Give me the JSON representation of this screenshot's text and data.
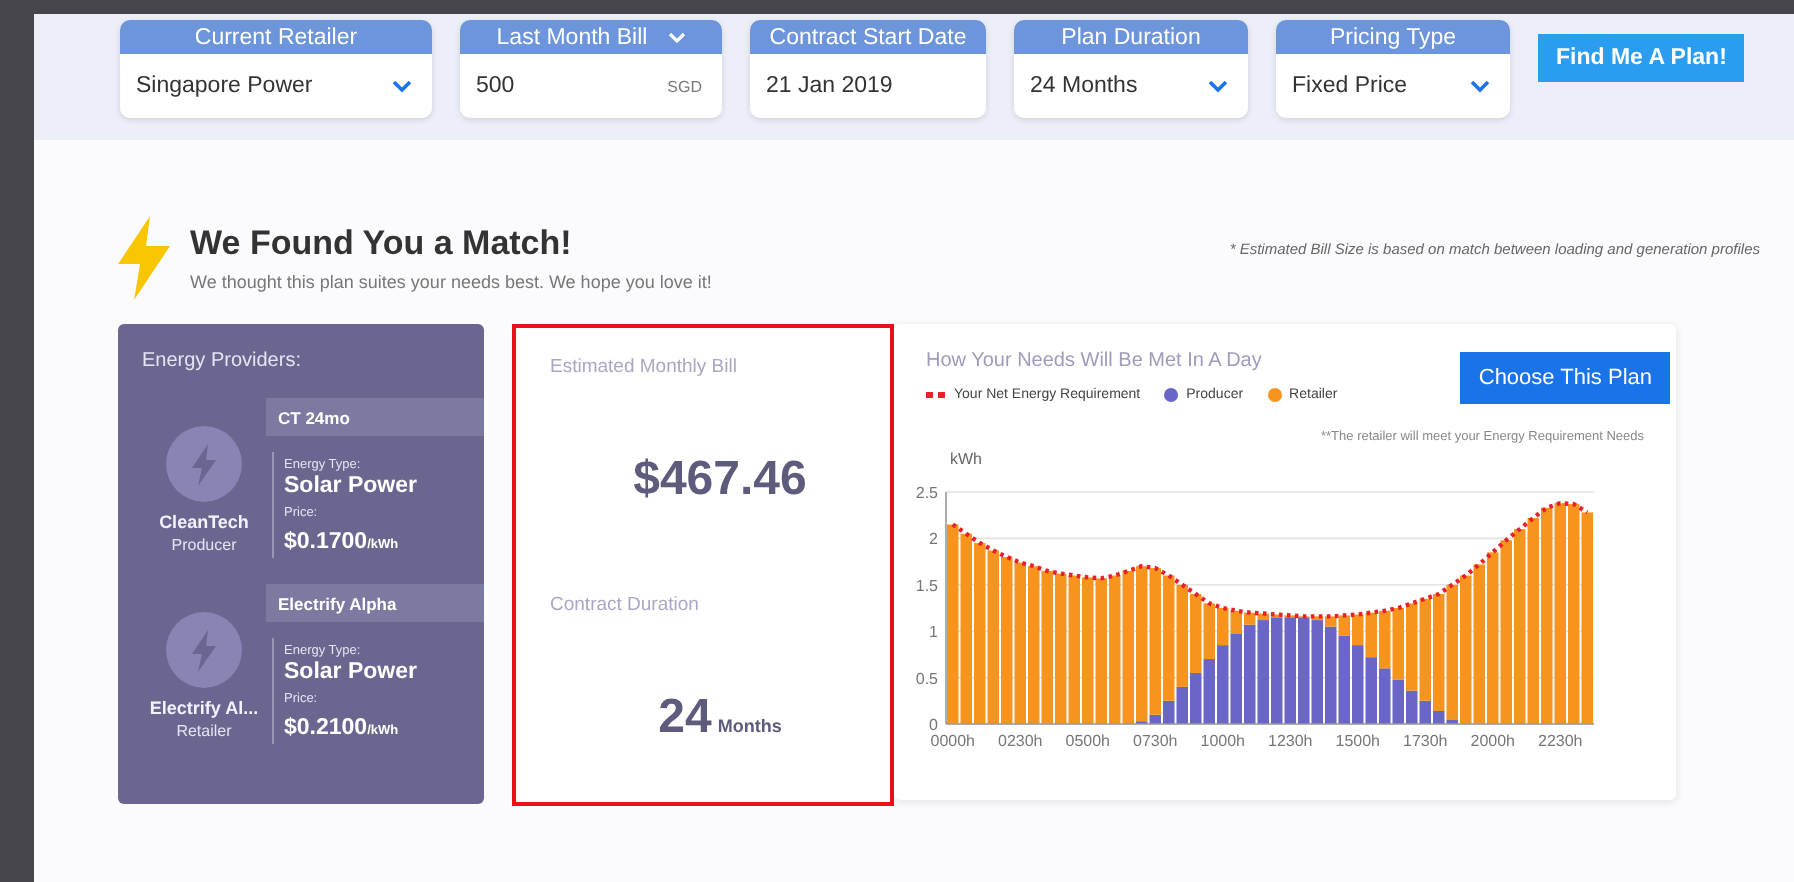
{
  "filters": [
    {
      "label": "Current Retailer",
      "value": "Singapore Power",
      "kind": "dropdown",
      "header_caret": false
    },
    {
      "label": "Last Month Bill",
      "value": "500",
      "suffix": "SGD",
      "kind": "amount",
      "header_caret": true
    },
    {
      "label": "Contract Start Date",
      "value": "21 Jan 2019",
      "kind": "date",
      "header_caret": false
    },
    {
      "label": "Plan Duration",
      "value": "24 Months",
      "kind": "dropdown",
      "header_caret": false
    },
    {
      "label": "Pricing Type",
      "value": "Fixed Price",
      "kind": "dropdown",
      "header_caret": false
    }
  ],
  "search_button": "Find Me A Plan!",
  "match": {
    "title": "We Found You a Match!",
    "subtitle": "We thought this plan suites your needs best. We hope you love it!",
    "note": "* Estimated Bill Size is based on match between loading and generation profiles"
  },
  "providers": {
    "title": "Energy Providers:",
    "items": [
      {
        "name": "CleanTech",
        "role": "Producer",
        "plan": "CT 24mo",
        "type_label": "Energy Type:",
        "type": "Solar Power",
        "price_label": "Price:",
        "price": "$0.1700",
        "unit": "/kWh"
      },
      {
        "name": "Electrify Al...",
        "role": "Retailer",
        "plan": "Electrify Alpha",
        "type_label": "Energy Type:",
        "type": "Solar Power",
        "price_label": "Price:",
        "price": "$0.2100",
        "unit": "/kWh"
      }
    ]
  },
  "bill": {
    "highlighted": true,
    "bill_label": "Estimated Monthly Bill",
    "bill": "$467.46",
    "duration_label": "Contract Duration",
    "duration": "24",
    "duration_unit": "Months"
  },
  "needs": {
    "title": "How Your Needs Will Be Met In A Day",
    "button": "Choose This Plan",
    "note": "**The retailer will meet your Energy Requirement Needs",
    "chart_data": {
      "type": "bar",
      "stacked": true,
      "grid": true,
      "ylabel": "kWh",
      "ylim": [
        0,
        2.5
      ],
      "yticks": [
        0,
        0.5,
        1,
        {
          "value": 1.5,
          "label": "1.5"
        },
        2,
        {
          "value": 2.5,
          "label": "2.5"
        }
      ],
      "categories": [
        "0000h",
        null,
        null,
        null,
        null,
        "0230h",
        null,
        null,
        null,
        null,
        "0500h",
        null,
        null,
        null,
        null,
        "0730h",
        null,
        null,
        null,
        null,
        "1000h",
        null,
        null,
        null,
        null,
        "1230h",
        null,
        null,
        null,
        null,
        "1500h",
        null,
        null,
        null,
        null,
        "1730h",
        null,
        null,
        null,
        null,
        "2000h",
        null,
        null,
        null,
        null,
        "2230h",
        null,
        null
      ],
      "series": [
        {
          "name": "Your Net Energy Requirement",
          "type": "line",
          "line_style": "dotted",
          "color": "#e8202a",
          "values": [
            2.15,
            2.05,
            1.95,
            1.87,
            1.8,
            1.74,
            1.7,
            1.65,
            1.62,
            1.6,
            1.58,
            1.57,
            1.6,
            1.65,
            1.7,
            1.68,
            1.6,
            1.5,
            1.4,
            1.3,
            1.25,
            1.22,
            1.2,
            1.19,
            1.18,
            1.17,
            1.16,
            1.16,
            1.16,
            1.17,
            1.18,
            1.2,
            1.22,
            1.25,
            1.3,
            1.35,
            1.4,
            1.5,
            1.6,
            1.72,
            1.85,
            1.98,
            2.1,
            2.22,
            2.33,
            2.38,
            2.37,
            2.28
          ]
        },
        {
          "name": "Producer",
          "color": "#6a66c8",
          "values": [
            0,
            0,
            0,
            0,
            0,
            0,
            0,
            0,
            0,
            0,
            0,
            0,
            0,
            0,
            0.03,
            0.1,
            0.25,
            0.4,
            0.55,
            0.7,
            0.85,
            0.97,
            1.07,
            1.12,
            1.15,
            1.15,
            1.15,
            1.12,
            1.05,
            0.95,
            0.85,
            0.72,
            0.6,
            0.48,
            0.36,
            0.25,
            0.14,
            0.05,
            0,
            0,
            0,
            0,
            0,
            0,
            0,
            0,
            0,
            0
          ]
        },
        {
          "name": "Retailer",
          "color": "#f7941d",
          "values": [
            2.15,
            2.05,
            1.95,
            1.87,
            1.8,
            1.74,
            1.7,
            1.65,
            1.62,
            1.6,
            1.58,
            1.57,
            1.6,
            1.65,
            1.67,
            1.58,
            1.35,
            1.1,
            0.85,
            0.6,
            0.4,
            0.25,
            0.13,
            0.07,
            0.03,
            0.02,
            0.01,
            0.04,
            0.11,
            0.22,
            0.33,
            0.48,
            0.62,
            0.77,
            0.94,
            1.1,
            1.26,
            1.45,
            1.6,
            1.72,
            1.85,
            1.98,
            2.1,
            2.22,
            2.33,
            2.38,
            2.37,
            2.28
          ]
        }
      ]
    }
  }
}
